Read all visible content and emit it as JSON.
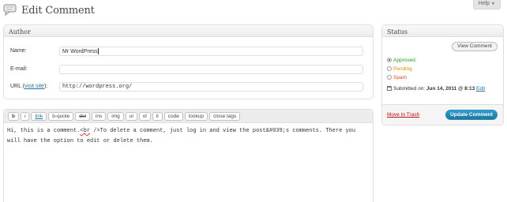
{
  "header": {
    "title": "Edit Comment",
    "page_icon": "comment-bubble-icon",
    "help_label": "Help"
  },
  "author": {
    "title": "Author",
    "name_label": "Name:",
    "name_value": "Mr WordPress",
    "email_label": "E-mail:",
    "email_value": "",
    "url_label_prefix": "URL (",
    "url_link_text": "visit site",
    "url_label_suffix": "):",
    "url_value": "http://wordpress.org/"
  },
  "status": {
    "title": "Status",
    "view_comment_label": "View Comment",
    "options": [
      {
        "label": "Approved",
        "color": "#21a01f",
        "checked": true
      },
      {
        "label": "Pending",
        "color": "#e68a00",
        "checked": false
      },
      {
        "label": "Spam",
        "color": "#d54e21",
        "checked": false
      }
    ],
    "submitted_prefix": "Submitted on:",
    "submitted_date": "Jun 14, 2011 @ 8:13",
    "edit_link": "Edit",
    "trash_label": "Move to Trash",
    "update_label": "Update Comment"
  },
  "editor": {
    "buttons": [
      "b",
      "i",
      "link",
      "b-quote",
      "del",
      "ins",
      "img",
      "ul",
      "ol",
      "li",
      "code",
      "lookup",
      "close tags"
    ],
    "content_before": "Hi, this is a comment.",
    "content_tag": "<br",
    "content_after": " />To delete a comment, just log in and view the post&#039;s comments. There you will have the option to edit or delete them."
  }
}
